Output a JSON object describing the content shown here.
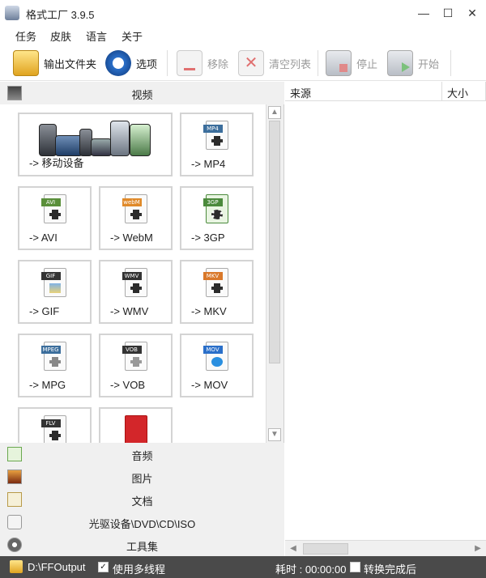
{
  "window": {
    "title": "格式工厂 3.9.5",
    "minimize": "—",
    "maximize": "☐",
    "close": "✕"
  },
  "menu": [
    "任务",
    "皮肤",
    "语言",
    "关于"
  ],
  "toolbar": [
    {
      "label": "输出文件夹",
      "icon": "output-folder-icon",
      "enabled": true
    },
    {
      "label": "选项",
      "icon": "options-icon",
      "enabled": true
    },
    {
      "label": "移除",
      "icon": "remove-icon",
      "enabled": false
    },
    {
      "label": "清空列表",
      "icon": "clear-list-icon",
      "enabled": false
    },
    {
      "label": "停止",
      "icon": "stop-icon",
      "enabled": false
    },
    {
      "label": "开始",
      "icon": "start-icon",
      "enabled": false
    }
  ],
  "categories": {
    "video": "视频",
    "audio": "音频",
    "picture": "图片",
    "document": "文档",
    "optical": "光驱设备\\DVD\\CD\\ISO",
    "tools": "工具集"
  },
  "video_tiles": [
    {
      "label": "-> 移动设备",
      "tag": ""
    },
    {
      "label": "-> MP4",
      "tag": "MP4"
    },
    {
      "label": "-> AVI",
      "tag": "AVI"
    },
    {
      "label": "-> WebM",
      "tag": "webM"
    },
    {
      "label": "-> 3GP",
      "tag": "3GP"
    },
    {
      "label": "-> GIF",
      "tag": "GIF"
    },
    {
      "label": "-> WMV",
      "tag": "WMV"
    },
    {
      "label": "-> MKV",
      "tag": "MKV"
    },
    {
      "label": "-> MPG",
      "tag": "MPEG"
    },
    {
      "label": "-> VOB",
      "tag": "VOB"
    },
    {
      "label": "-> MOV",
      "tag": "MOV"
    },
    {
      "label": "",
      "tag": "FLV"
    },
    {
      "label": "",
      "tag": ""
    }
  ],
  "task_list": {
    "columns": [
      "来源",
      "大小"
    ]
  },
  "status": {
    "output_path": "D:\\FFOutput",
    "multithread_label": "使用多线程",
    "multithread_checked": true,
    "elapsed_label": "耗时 : 00:00:00",
    "after_convert_label": "转换完成后",
    "after_convert_checked": false
  },
  "colors": {
    "status_bg": "#4a4a4a",
    "panel_bg": "#f0f0f0",
    "tile_border": "#d4d4d4"
  }
}
